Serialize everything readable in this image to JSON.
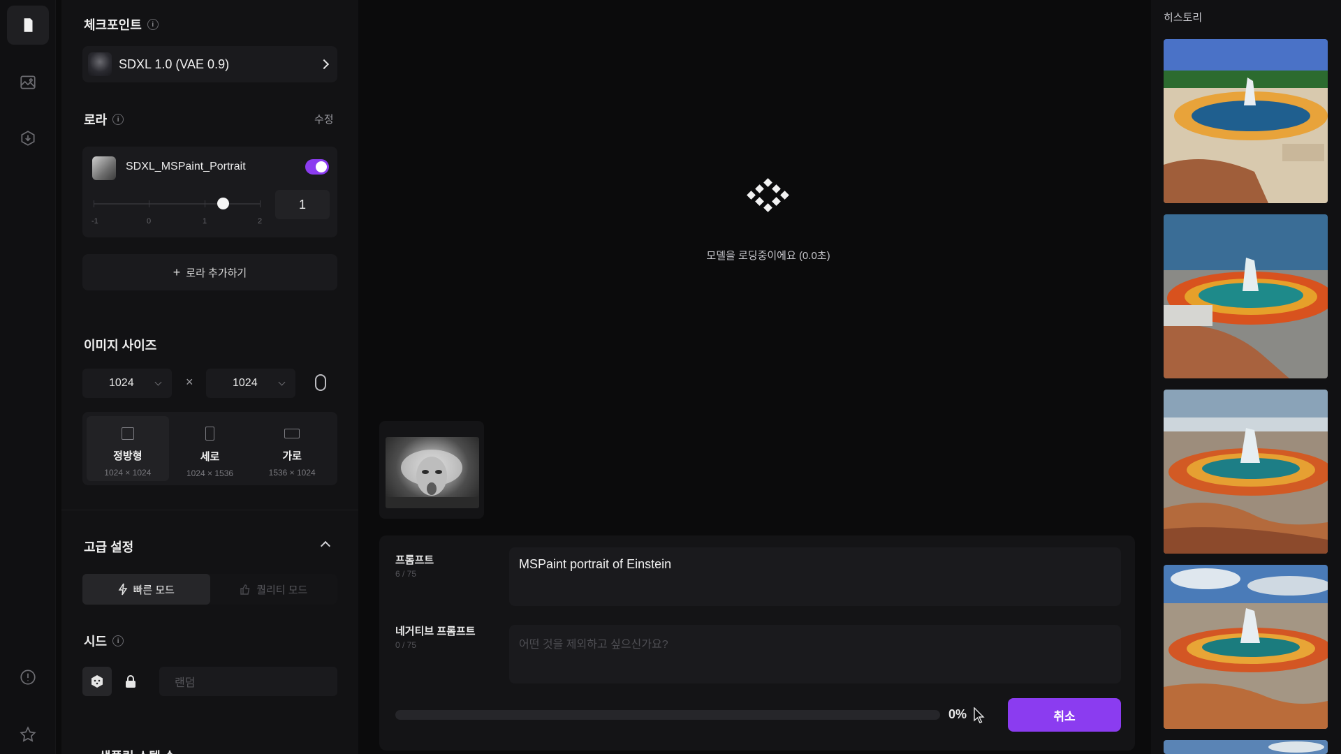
{
  "colors": {
    "accent": "#8b3cf0",
    "background": "#0b0b0c",
    "panel": "#121214"
  },
  "rail": {
    "items": [
      {
        "name": "document-icon",
        "active": true
      },
      {
        "name": "image-icon",
        "active": false
      },
      {
        "name": "download-icon",
        "active": false
      }
    ],
    "bottom": [
      "alert-circle-icon",
      "star-icon"
    ]
  },
  "checkpoint": {
    "title": "체크포인트",
    "model_name": "SDXL 1.0 (VAE 0.9)"
  },
  "lora": {
    "title": "로라",
    "edit_label": "수정",
    "item_name": "SDXL_MSPaint_Portrait",
    "enabled": true,
    "weight": "1",
    "slider_labels": [
      "-1",
      "0",
      "1",
      "2"
    ],
    "add_label": "로라 추가하기"
  },
  "image_size": {
    "title": "이미지 사이즈",
    "width": "1024",
    "height": "1024",
    "times": "×",
    "ratios": [
      {
        "name": "정방형",
        "dims": "1024 × 1024"
      },
      {
        "name": "세로",
        "dims": "1024 × 1536"
      },
      {
        "name": "가로",
        "dims": "1536 × 1024"
      }
    ]
  },
  "advanced": {
    "title": "고급 설정",
    "fast_mode": "빠른 모드",
    "quality_mode": "퀄리티 모드"
  },
  "seed": {
    "title": "시드",
    "placeholder": "랜덤"
  },
  "cutoff_title": "샘플링 스텝 수",
  "main": {
    "loading_text": "모델을 로딩중이에요 (0.0초)",
    "prompt_label": "프롬프트",
    "prompt_count": "6 / 75",
    "prompt_value": "MSPaint portrait of Einstein",
    "negative_label": "네거티브 프롬프트",
    "negative_count": "0 / 75",
    "negative_placeholder": "어떤 것을 제외하고 싶으신가요?",
    "progress_percent": 0,
    "progress_text": "0%",
    "cancel_label": "취소"
  },
  "history": {
    "title": "히스토리"
  }
}
